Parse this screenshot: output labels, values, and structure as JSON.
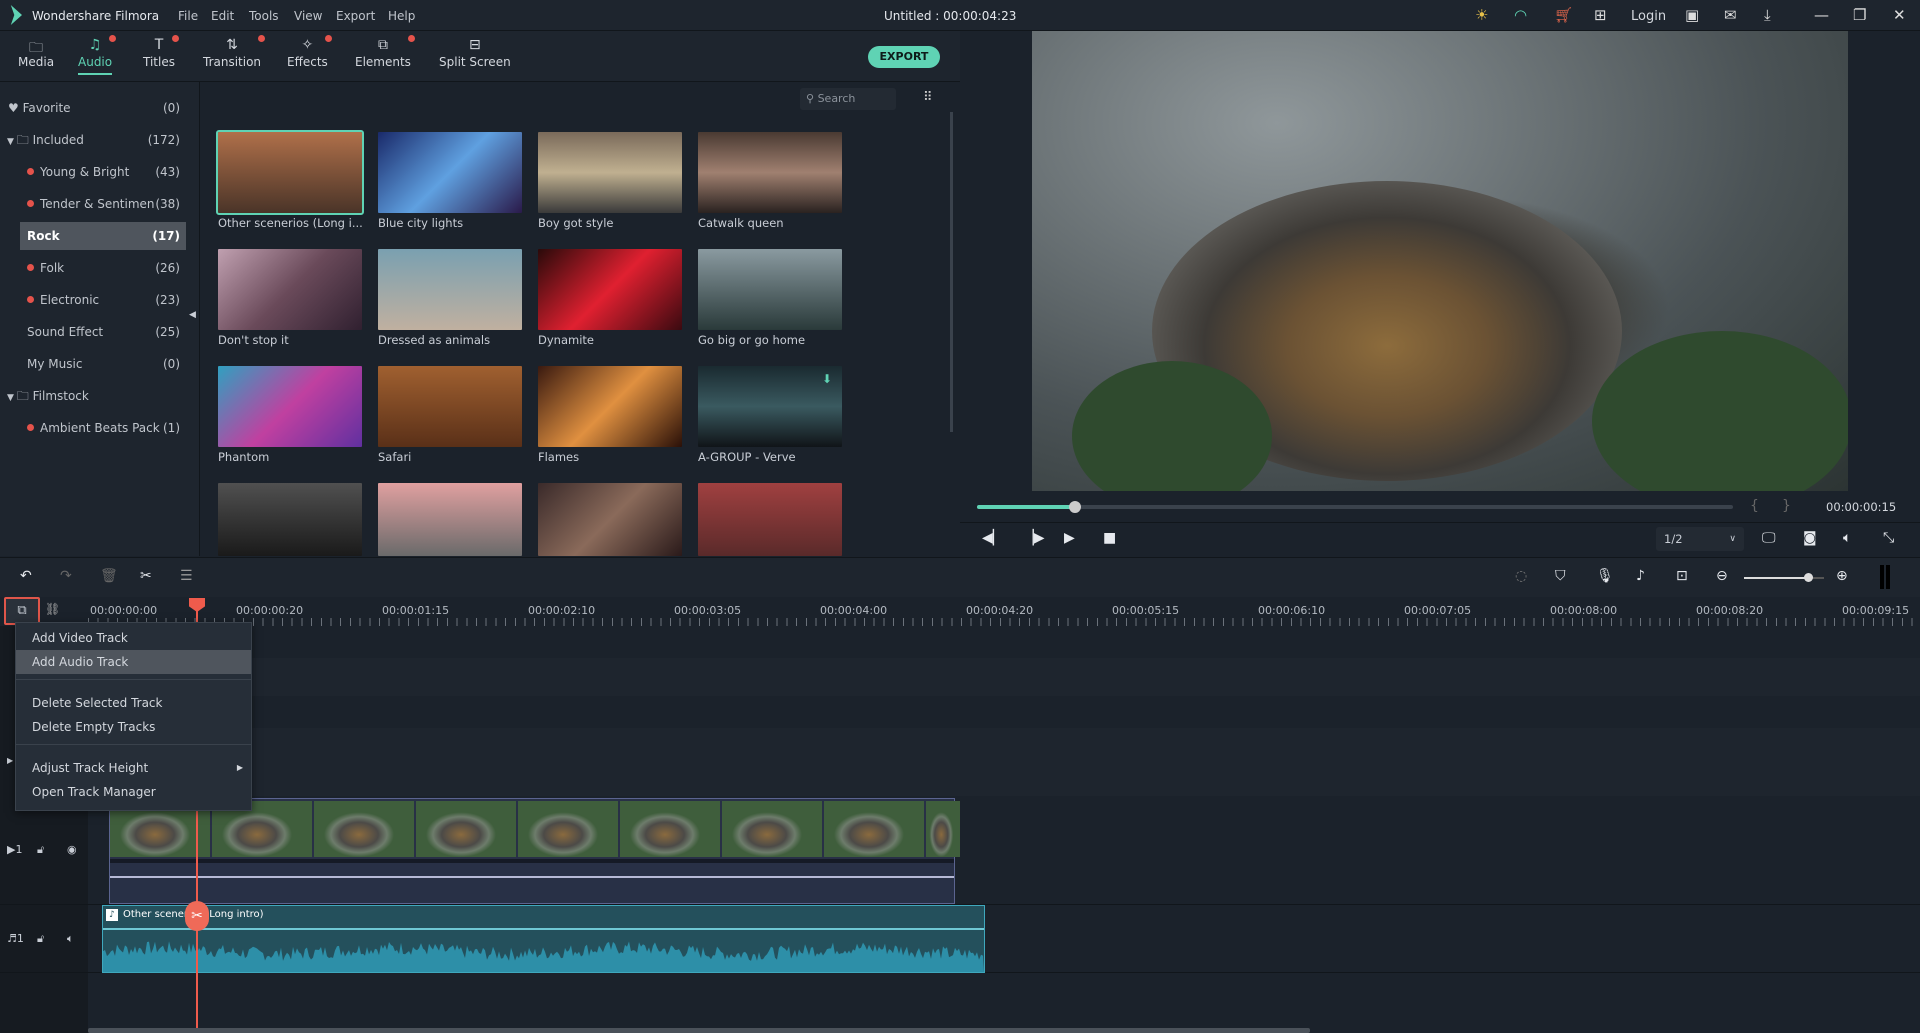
{
  "app": {
    "name": "Wondershare Filmora",
    "title": "Untitled : 00:00:04:23",
    "login": "Login"
  },
  "menu": [
    "File",
    "Edit",
    "Tools",
    "View",
    "Export",
    "Help"
  ],
  "tabs": [
    {
      "label": "Media",
      "dot": false
    },
    {
      "label": "Audio",
      "dot": true,
      "active": true
    },
    {
      "label": "Titles",
      "dot": true
    },
    {
      "label": "Transition",
      "dot": true
    },
    {
      "label": "Effects",
      "dot": true
    },
    {
      "label": "Elements",
      "dot": true
    },
    {
      "label": "Split Screen",
      "dot": false
    }
  ],
  "export_label": "EXPORT",
  "search_placeholder": "Search",
  "sidebar": [
    {
      "label": "Favorite",
      "count": "(0)"
    },
    {
      "label": "Included",
      "count": "(172)"
    },
    {
      "label": "Young & Bright",
      "count": "(43)"
    },
    {
      "label": "Tender & Sentimen",
      "count": "(38)"
    },
    {
      "label": "Rock",
      "count": "(17)"
    },
    {
      "label": "Folk",
      "count": "(26)"
    },
    {
      "label": "Electronic",
      "count": "(23)"
    },
    {
      "label": "Sound Effect",
      "count": "(25)"
    },
    {
      "label": "My Music",
      "count": "(0)"
    },
    {
      "label": "Filmstock",
      "count": ""
    },
    {
      "label": "Ambient Beats Pack",
      "count": "(1)"
    }
  ],
  "library": [
    {
      "title": "Other scenerios  (Long i...",
      "selected": true
    },
    {
      "title": "Blue city lights"
    },
    {
      "title": "Boy got style"
    },
    {
      "title": "Catwalk queen"
    },
    {
      "title": "Don't stop it"
    },
    {
      "title": "Dressed as animals"
    },
    {
      "title": "Dynamite"
    },
    {
      "title": "Go big or go home"
    },
    {
      "title": "Phantom"
    },
    {
      "title": "Safari"
    },
    {
      "title": "Flames"
    },
    {
      "title": "A-GROUP - Verve",
      "download": true
    },
    {
      "title": ""
    },
    {
      "title": ""
    },
    {
      "title": ""
    },
    {
      "title": ""
    }
  ],
  "preview": {
    "timecode": "00:00:00:15",
    "progress": 0.13,
    "quality": "1/2"
  },
  "ruler": [
    "00:00:00:00",
    "00:00:00:20",
    "00:00:01:15",
    "00:00:02:10",
    "00:00:03:05",
    "00:00:04:00",
    "00:00:04:20",
    "00:00:05:15",
    "00:00:06:10",
    "00:00:07:05",
    "00:00:08:00",
    "00:00:08:20",
    "00:00:09:15"
  ],
  "context_menu": {
    "items": [
      "Add Video Track",
      "Add Audio Track",
      "Delete Selected Track",
      "Delete Empty Tracks",
      "Adjust Track Height",
      "Open Track Manager"
    ]
  },
  "tracks": {
    "video_label": "1",
    "audio_label": "1",
    "audio_clip": "Other scenerios (Long intro)"
  },
  "zoom_level": 0.8,
  "colors": {
    "accent": "#5fd3b4",
    "playhead": "#ef5b4c",
    "audio_clip": "#2d8fa8"
  }
}
